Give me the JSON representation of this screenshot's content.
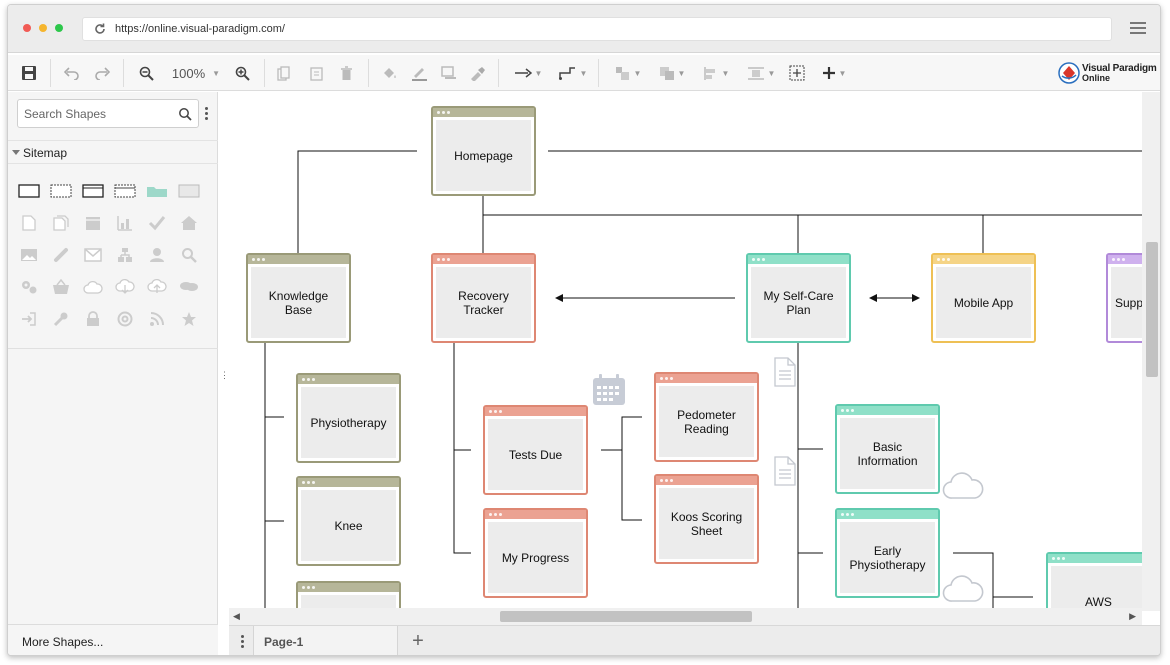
{
  "browser": {
    "url": "https://online.visual-paradigm.com/",
    "dot_colors": [
      "#f15b55",
      "#f5b52e",
      "#2dc74b"
    ]
  },
  "toolbar": {
    "zoom_level": "100%",
    "logo_line1": "Visual Paradigm",
    "logo_line2": "Online"
  },
  "sidebar": {
    "search_placeholder": "Search Shapes",
    "section_label": "Sitemap",
    "more_shapes_label": "More Shapes..."
  },
  "pages": {
    "active_tab": "Page-1"
  },
  "diagram": {
    "nodes": {
      "homepage": "Homepage",
      "knowledge_base": "Knowledge Base",
      "recovery_tracker": "Recovery Tracker",
      "self_care_plan": "My Self-Care Plan",
      "mobile_app": "Mobile App",
      "support": "Supp",
      "physiotherapy": "Physiotherapy",
      "knee": "Knee",
      "tests_due": "Tests Due",
      "my_progress": "My Progress",
      "pedometer_reading": "Pedometer Reading",
      "koos_scoring_sheet": "Koos Scoring Sheet",
      "basic_information": "Basic Information",
      "early_physiotherapy": "Early Physiotherapy",
      "aws": "AWS"
    },
    "colors": {
      "olive": "#9a9a78",
      "salmon": "#de8773",
      "teal": "#5fcaae",
      "yellow": "#eec055",
      "purple": "#b18ad9"
    }
  }
}
